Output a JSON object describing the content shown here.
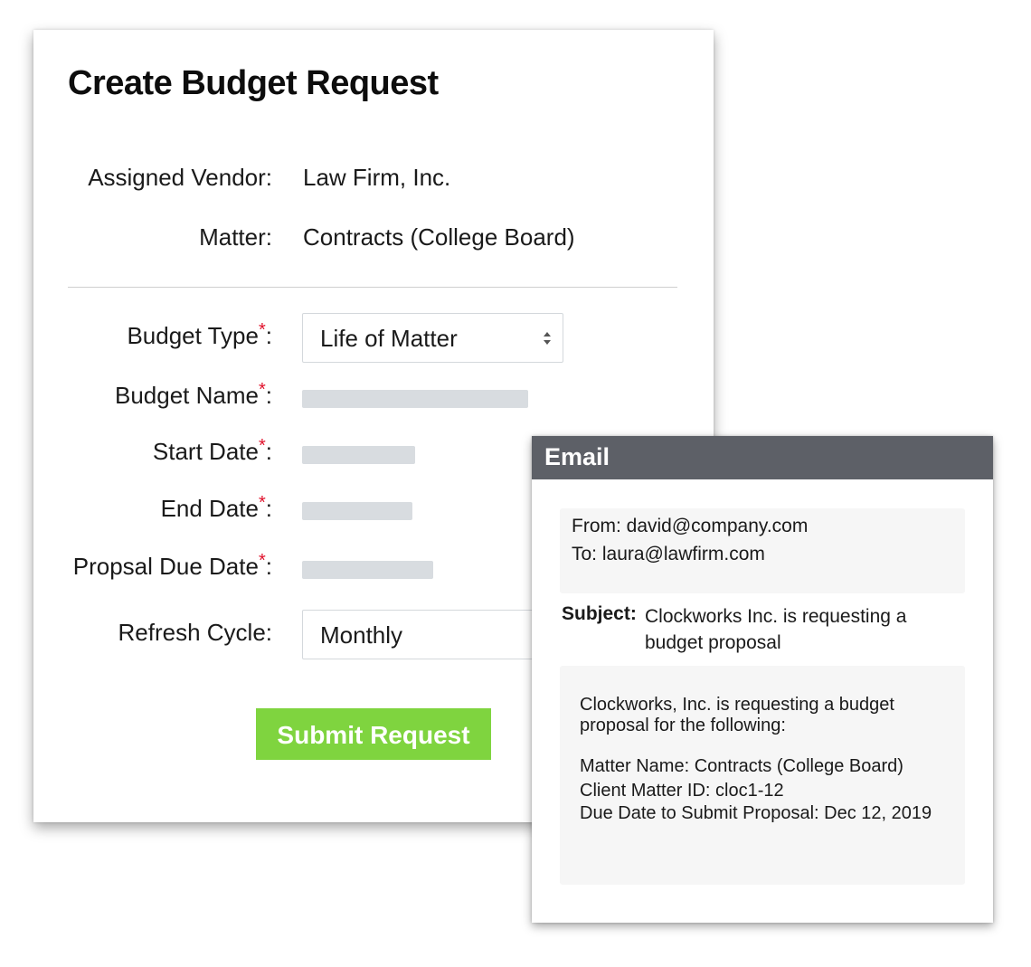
{
  "form": {
    "title": "Create Budget Request",
    "info": [
      {
        "label": "Assigned Vendor:",
        "value": "Law Firm, Inc."
      },
      {
        "label": "Matter:",
        "value": "Contracts (College Board)"
      }
    ],
    "fields": {
      "budget_type": {
        "label": "Budget Type",
        "required_mark": "*",
        "colon": ":",
        "value": "Life of Matter"
      },
      "budget_name": {
        "label": "Budget Name",
        "required_mark": "*",
        "colon": ":"
      },
      "start_date": {
        "label": "Start Date",
        "required_mark": "*",
        "colon": ":"
      },
      "end_date": {
        "label": "End Date",
        "required_mark": "*",
        "colon": ":"
      },
      "proposal_due_date": {
        "label": "Propsal Due Date",
        "required_mark": "*",
        "colon": ":"
      },
      "refresh_cycle": {
        "label": "Refresh Cycle:",
        "value": "Monthly"
      }
    },
    "submit_label": "Submit Request",
    "colors": {
      "submit": "#7fd43f",
      "required": "#e0112b"
    }
  },
  "email": {
    "header": "Email",
    "from": "From: david@company.com",
    "to": "To: laura@lawfirm.com",
    "subject_label": "Subject:",
    "subject": "Clockworks Inc. is requesting a budget proposal",
    "body_intro": "Clockworks, Inc. is requesting a budget proposal for the following:",
    "body_lines": [
      "Matter Name: Contracts (College Board)",
      "Client Matter ID: cloc1-12",
      "Due Date to Submit Proposal: Dec 12, 2019"
    ],
    "colors": {
      "header_bg": "#5d6067"
    }
  }
}
